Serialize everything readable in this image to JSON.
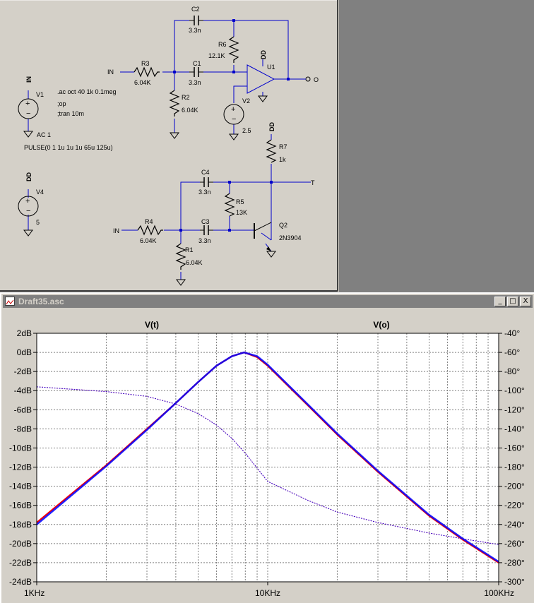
{
  "schematic": {
    "directives": [
      ".ac oct 40 1k 0.1meg",
      ";op",
      ";tran 10m"
    ],
    "sources": {
      "v1": {
        "name": "V1",
        "node": "IN",
        "value": "AC 1",
        "extra": "PULSE(0 1 1u 1u 1u 65u 125u)"
      },
      "v2": {
        "name": "V2",
        "value": "2.5"
      },
      "v4": {
        "name": "V4",
        "node": "DD",
        "value": "5"
      }
    },
    "parts": {
      "c2": {
        "name": "C2",
        "value": "3.3n"
      },
      "r6": {
        "name": "R6",
        "value": "12.1K"
      },
      "r3": {
        "name": "R3",
        "value": "6.04K"
      },
      "c1": {
        "name": "C1",
        "value": "3.3n"
      },
      "r2": {
        "name": "R2",
        "value": "6.04K"
      },
      "u1": {
        "name": "U1",
        "supply": "DD"
      },
      "r7": {
        "name": "R7",
        "value": "1k",
        "supply": "DD"
      },
      "c4": {
        "name": "C4",
        "value": "3.3n"
      },
      "r5": {
        "name": "R5",
        "value": "13K"
      },
      "r4": {
        "name": "R4",
        "value": "6.04K"
      },
      "c3": {
        "name": "C3",
        "value": "3.3n"
      },
      "r1": {
        "name": "R1",
        "value": "6.04K"
      },
      "q2": {
        "name": "Q2",
        "model": "2N3904"
      }
    },
    "labels": {
      "in_top": "IN",
      "in_bottom": "IN",
      "out_o": "O",
      "out_t": "T"
    }
  },
  "window": {
    "title": "Draft35.asc",
    "buttons": {
      "minimize": "_",
      "maximize": "□",
      "close": "X"
    }
  },
  "chart_data": {
    "type": "line",
    "xscale": "log",
    "xlim": [
      1000,
      100000
    ],
    "x_ticks": [
      "1KHz",
      "10KHz",
      "100KHz"
    ],
    "ylim_left": [
      -24,
      2
    ],
    "y_ticks_left": [
      "2dB",
      "0dB",
      "-2dB",
      "-4dB",
      "-6dB",
      "-8dB",
      "-10dB",
      "-12dB",
      "-14dB",
      "-16dB",
      "-18dB",
      "-20dB",
      "-22dB",
      "-24dB"
    ],
    "ylim_right": [
      -300,
      -40
    ],
    "y_ticks_right": [
      "-40°",
      "-60°",
      "-80°",
      "-100°",
      "-120°",
      "-140°",
      "-160°",
      "-180°",
      "-200°",
      "-220°",
      "-240°",
      "-260°",
      "-280°",
      "-300°"
    ],
    "grid": true,
    "series": [
      {
        "name": "V(t)",
        "color": "#ff0000",
        "x": [
          1000,
          2000,
          3000,
          4000,
          5000,
          6000,
          7000,
          7900,
          9000,
          10000,
          15000,
          20000,
          30000,
          50000,
          70000,
          100000
        ],
        "mag_db": [
          -17.8,
          -11.8,
          -8.0,
          -5.3,
          -3.1,
          -1.4,
          -0.4,
          0,
          -0.5,
          -1.4,
          -5.6,
          -8.6,
          -12.5,
          -17.1,
          -19.6,
          -22.0
        ],
        "phase_deg": [
          -96,
          -101,
          -106,
          -114,
          -124,
          -136,
          -150,
          -164,
          -181,
          -195,
          -215,
          -227,
          -238,
          -249,
          -255,
          -261
        ]
      },
      {
        "name": "V(o)",
        "color": "#0000ff",
        "x": [
          1000,
          2000,
          3000,
          4000,
          5000,
          6000,
          7000,
          7900,
          9000,
          10000,
          15000,
          20000,
          30000,
          50000,
          70000,
          100000
        ],
        "mag_db": [
          -18.0,
          -11.9,
          -8.1,
          -5.3,
          -3.1,
          -1.4,
          -0.4,
          0,
          -0.4,
          -1.3,
          -5.5,
          -8.5,
          -12.4,
          -17.0,
          -19.5,
          -21.9
        ],
        "phase_deg": [
          -96,
          -101,
          -106,
          -114,
          -124,
          -136,
          -150,
          -164,
          -181,
          -195,
          -215,
          -227,
          -238,
          -249,
          -255,
          -261
        ]
      }
    ]
  }
}
